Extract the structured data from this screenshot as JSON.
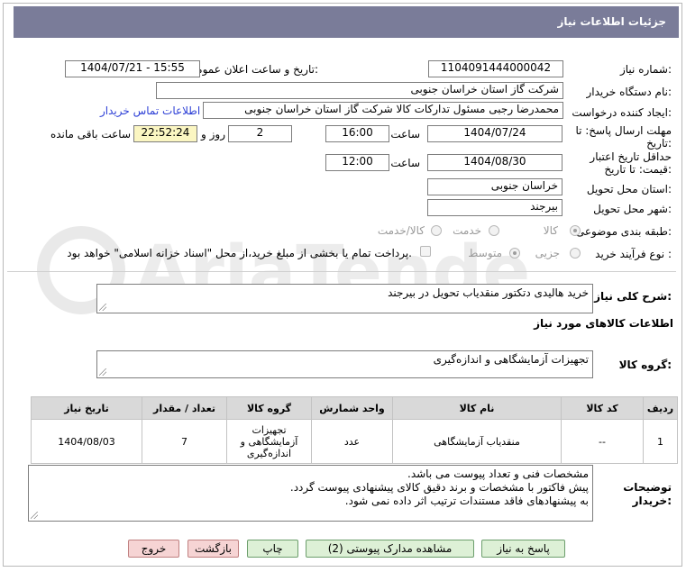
{
  "header": {
    "title": "جزئیات اطلاعات نیاز"
  },
  "form": {
    "need_number_label": "شماره نیاز:",
    "need_number": "1104091444000042",
    "announce_label": "تاریخ و ساعت اعلان عمومی:",
    "announce_value": "1404/07/21 - 15:55",
    "buyer_org_label": "نام دستگاه خریدار:",
    "buyer_org": "شرکت گاز استان خراسان جنوبی",
    "requester_label": "ایجاد کننده درخواست:",
    "requester": "محمدرضا رجبی مسئول تدارکات کالا شرکت گاز استان خراسان جنوبی",
    "contact_link": "اطلاعات تماس خریدار",
    "deadline_label_1": "مهلت ارسال پاسخ: تا",
    "deadline_label_2": "تاریخ:",
    "deadline_date": "1404/07/24",
    "time_label": "ساعت",
    "deadline_time": "16:00",
    "days_value": "2",
    "days_label": "روز و",
    "remaining_time": "22:52:24",
    "remaining_label": "ساعت باقی مانده",
    "validity_label_1": "حداقل تاریخ اعتبار",
    "validity_label_2": "قیمت: تا تاریخ:",
    "validity_date": "1404/08/30",
    "validity_time_label": "ساعت",
    "validity_time": "12:00",
    "province_label": "استان محل تحویل:",
    "province": "خراسان جنوبی",
    "city_label": "شهر محل تحویل:",
    "city": "بیرجند",
    "category_label": "طبقه بندی موضوعی:",
    "category_options": [
      "کالا",
      "خدمت",
      "کالا/خدمت"
    ],
    "process_label": "نوع فرآیند خرید :",
    "process_options": [
      "جزیی",
      "متوسط"
    ],
    "payment_text": "پرداخت تمام یا بخشی از مبلغ خرید،از محل \"اسناد خزانه اسلامی\" خواهد بود.",
    "summary_label": "شرح کلی نیاز:",
    "summary": "خرید هالیدی دتکتور منقدیاب تحویل در بیرجند",
    "goods_info_title": "اطلاعات کالاهای مورد نیاز",
    "goods_group_label": "گروه کالا:",
    "goods_group": "تجهیزات آزمایشگاهی و اندازه‌گیری"
  },
  "table": {
    "headers": [
      "ردیف",
      "کد کالا",
      "نام کالا",
      "واحد شمارش",
      "گروه کالا",
      "تعداد / مقدار",
      "تاریخ نیاز"
    ],
    "rows": [
      {
        "row": "1",
        "code": "--",
        "name": "منقدیاب آزمایشگاهی",
        "unit": "عدد",
        "group_1": "تجهیزات",
        "group_2": "آزمایشگاهی و",
        "group_3": "اندازه‌گیری",
        "qty": "7",
        "date": "1404/08/03"
      }
    ]
  },
  "notes": {
    "label_1": "توضیحات",
    "label_2": "خریدار:",
    "line_1": "مشخصات فنی و تعداد پیوست می باشد.",
    "line_2": "پیش فاکتور با مشخصات و برند دقیق کالای پیشنهادی پیوست گردد.",
    "line_3": "به پیشنهادهای فاقد مستندات ترتیب اثر داده نمی شود."
  },
  "buttons": {
    "reply": "پاسخ به نیاز",
    "docs": "مشاهده مدارک پیوستی (2)",
    "print": "چاپ",
    "back": "بازگشت",
    "exit": "خروج"
  },
  "colors": {
    "header_bg": "#7a7c99",
    "button_green": "#ddf0d6",
    "button_pink": "#f6d4d4",
    "remaining_bg": "#fbf6c2"
  }
}
